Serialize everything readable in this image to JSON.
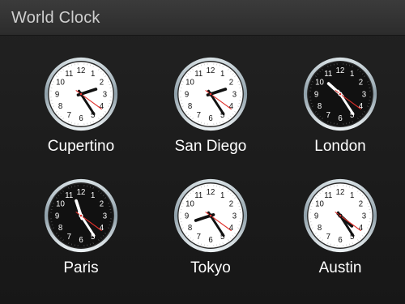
{
  "header": {
    "title": "World Clock"
  },
  "colors": {
    "background": "#1a1a1a",
    "day_face": "#ffffff",
    "night_face": "#111111",
    "second_hand": "#e0302b",
    "bezel": "#8fa0aa"
  },
  "face": {
    "numerals": [
      "12",
      "1",
      "2",
      "3",
      "4",
      "5",
      "6",
      "7",
      "8",
      "9",
      "10",
      "11"
    ]
  },
  "clocks": [
    {
      "city": "Cupertino",
      "theme": "day",
      "hour": 2.4,
      "minute": 24.5,
      "second": 21
    },
    {
      "city": "San Diego",
      "theme": "day",
      "hour": 2.4,
      "minute": 24.5,
      "second": 21
    },
    {
      "city": "London",
      "theme": "night",
      "hour": 10.4,
      "minute": 24.5,
      "second": 21
    },
    {
      "city": "Paris",
      "theme": "night",
      "hour": 11.4,
      "minute": 24.5,
      "second": 21
    },
    {
      "city": "Tokyo",
      "theme": "day",
      "hour": 8.4,
      "minute": 24.5,
      "second": 21
    },
    {
      "city": "Austin",
      "theme": "day",
      "hour": 4.4,
      "minute": 24.5,
      "second": 21
    }
  ]
}
